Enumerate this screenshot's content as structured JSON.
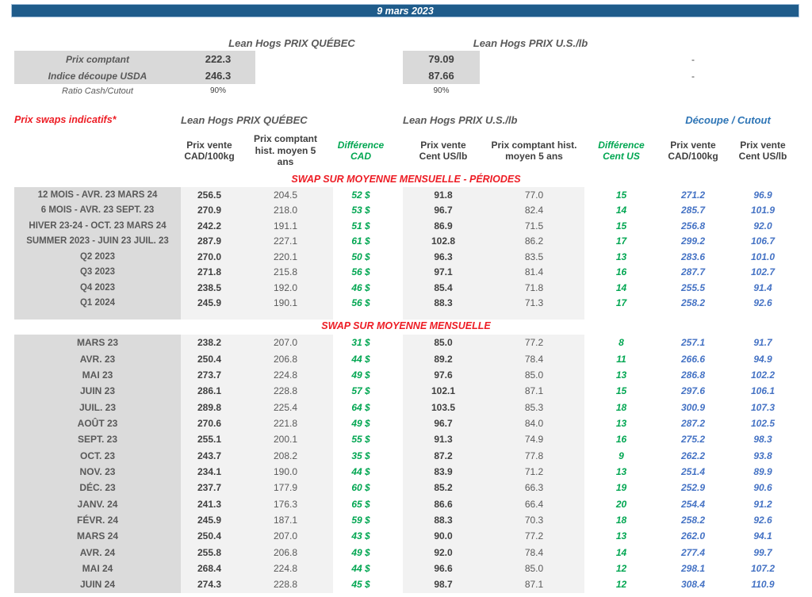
{
  "banner": {
    "date": "9 mars 2023"
  },
  "colors": {
    "banner_bg": "#1F5C8B",
    "red_accent": "#ED1C24",
    "green_diff": "#00A651",
    "blue_cutout": "#4472C4",
    "label_cell_bg": "#DBDBDB",
    "value_band_bg": "#F2F2F2"
  },
  "spot": {
    "quebec_title": "Lean Hogs PRIX QUÉBEC",
    "us_title": "Lean Hogs PRIX U.S./lb",
    "rows": [
      {
        "label": "Prix comptant",
        "qc": "222.3",
        "us": "79.09",
        "dec": "-"
      },
      {
        "label": "Indice découpe USDA",
        "qc": "246.3",
        "us": "87.66",
        "dec": "-"
      },
      {
        "label": "Ratio Cash/Cutout",
        "qc": "90%",
        "us": "90%",
        "dec": ""
      }
    ]
  },
  "swaps": {
    "title": "Prix swaps indicatifs*",
    "quebec_title": "Lean Hogs PRIX QUÉBEC",
    "us_title": "Lean Hogs PRIX U.S./lb",
    "decoupe_title": "Découpe / Cutout",
    "columns": [
      "Prix vente\nCAD/100kg",
      "Prix comptant\nhist. moyen 5\nans",
      "Différence\nCAD",
      "Prix vente\nCent US/lb",
      "Prix comptant hist.\nmoyen 5 ans",
      "Différence\nCent US",
      "Prix vente\nCAD/100kg",
      "Prix vente\nCent US/lb"
    ],
    "sections": [
      {
        "title": "SWAP SUR MOYENNE MENSUELLE - PÉRIODES",
        "rows": [
          [
            "12 MOIS - AVR. 23 MARS 24",
            "256.5",
            "204.5",
            "52 $",
            "91.8",
            "77.0",
            "15",
            "271.2",
            "96.9"
          ],
          [
            "6 MOIS - AVR. 23 SEPT. 23",
            "270.9",
            "218.0",
            "53 $",
            "96.7",
            "82.4",
            "14",
            "285.7",
            "101.9"
          ],
          [
            "HIVER 23-24 -  OCT. 23 MARS 24",
            "242.2",
            "191.1",
            "51 $",
            "86.9",
            "71.5",
            "15",
            "256.8",
            "92.0"
          ],
          [
            "SUMMER 2023 - JUIN 23 JUIL. 23",
            "287.9",
            "227.1",
            "61 $",
            "102.8",
            "86.2",
            "17",
            "299.2",
            "106.7"
          ],
          [
            "Q2 2023",
            "270.0",
            "220.1",
            "50 $",
            "96.3",
            "83.5",
            "13",
            "283.6",
            "101.0"
          ],
          [
            "Q3 2023",
            "271.8",
            "215.8",
            "56 $",
            "97.1",
            "81.4",
            "16",
            "287.7",
            "102.7"
          ],
          [
            "Q4 2023",
            "238.5",
            "192.0",
            "46 $",
            "85.4",
            "71.8",
            "14",
            "255.5",
            "91.4"
          ],
          [
            "Q1 2024",
            "245.9",
            "190.1",
            "56 $",
            "88.3",
            "71.3",
            "17",
            "258.2",
            "92.6"
          ]
        ]
      },
      {
        "title": "SWAP SUR MOYENNE MENSUELLE",
        "rows": [
          [
            "MARS 23",
            "238.2",
            "207.0",
            "31 $",
            "85.0",
            "77.2",
            "8",
            "257.1",
            "91.7"
          ],
          [
            "AVR. 23",
            "250.4",
            "206.8",
            "44 $",
            "89.2",
            "78.4",
            "11",
            "266.6",
            "94.9"
          ],
          [
            "MAI 23",
            "273.7",
            "224.8",
            "49 $",
            "97.6",
            "85.0",
            "13",
            "286.8",
            "102.2"
          ],
          [
            "JUIN 23",
            "286.1",
            "228.8",
            "57 $",
            "102.1",
            "87.1",
            "15",
            "297.6",
            "106.1"
          ],
          [
            "JUIL. 23",
            "289.8",
            "225.4",
            "64 $",
            "103.5",
            "85.3",
            "18",
            "300.9",
            "107.3"
          ],
          [
            "AOÛT 23",
            "270.6",
            "221.8",
            "49 $",
            "96.7",
            "84.0",
            "13",
            "287.2",
            "102.5"
          ],
          [
            "SEPT. 23",
            "255.1",
            "200.1",
            "55 $",
            "91.3",
            "74.9",
            "16",
            "275.2",
            "98.3"
          ],
          [
            "OCT. 23",
            "243.7",
            "208.2",
            "35 $",
            "87.2",
            "77.8",
            "9",
            "262.2",
            "93.8"
          ],
          [
            "NOV. 23",
            "234.1",
            "190.0",
            "44 $",
            "83.9",
            "71.2",
            "13",
            "251.4",
            "89.9"
          ],
          [
            "DÉC. 23",
            "237.7",
            "177.9",
            "60 $",
            "85.2",
            "66.3",
            "19",
            "252.9",
            "90.6"
          ],
          [
            "JANV. 24",
            "241.3",
            "176.3",
            "65 $",
            "86.6",
            "66.4",
            "20",
            "254.4",
            "91.2"
          ],
          [
            "FÉVR. 24",
            "245.9",
            "187.1",
            "59 $",
            "88.3",
            "70.3",
            "18",
            "258.2",
            "92.6"
          ],
          [
            "MARS 24",
            "250.4",
            "207.0",
            "43 $",
            "90.0",
            "77.2",
            "13",
            "262.0",
            "94.1"
          ],
          [
            "AVR. 24",
            "255.8",
            "206.8",
            "49 $",
            "92.0",
            "78.4",
            "14",
            "277.4",
            "99.7"
          ],
          [
            "MAI 24",
            "268.4",
            "224.8",
            "44 $",
            "96.6",
            "85.0",
            "12",
            "298.1",
            "107.2"
          ],
          [
            "JUIN 24",
            "274.3",
            "228.8",
            "45 $",
            "98.7",
            "87.1",
            "12",
            "308.4",
            "110.9"
          ]
        ]
      }
    ]
  }
}
